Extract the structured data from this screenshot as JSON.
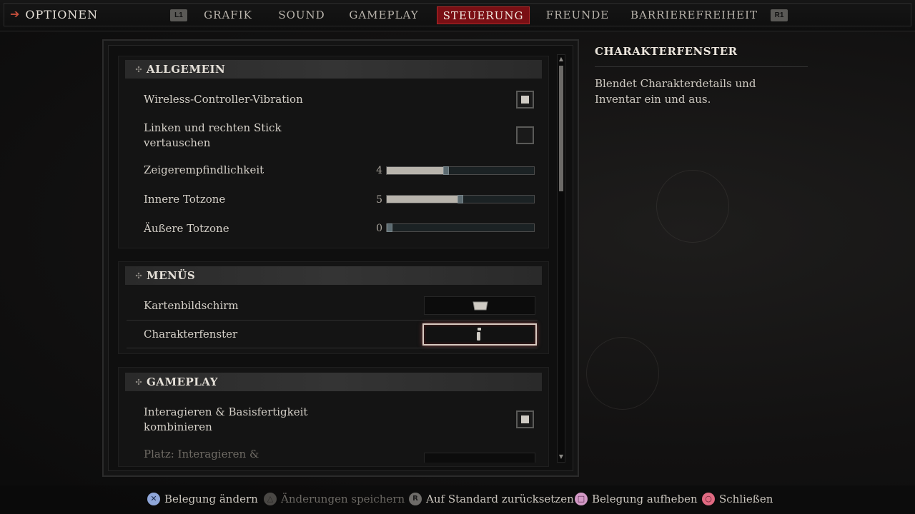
{
  "topbar": {
    "back_label": "OPTIONEN",
    "l1": "L1",
    "r1": "R1",
    "tabs": [
      {
        "label": "GRAFIK"
      },
      {
        "label": "SOUND"
      },
      {
        "label": "GAMEPLAY"
      },
      {
        "label": "STEUERUNG",
        "active": true
      },
      {
        "label": "FREUNDE"
      },
      {
        "label": "BARRIEREFREIHEIT"
      }
    ]
  },
  "sections": {
    "allgemein": {
      "title": "ALLGEMEIN",
      "vibration": {
        "label": "Wireless-Controller-Vibration",
        "checked": true
      },
      "swap_sticks": {
        "label_line1": "Linken und rechten Stick",
        "label_line2": "vertauschen",
        "checked": false
      },
      "pointer_sens": {
        "label": "Zeigerempfindlichkeit",
        "value": "4",
        "fraction": 0.4
      },
      "inner_deadzone": {
        "label": "Innere Totzone",
        "value": "5",
        "fraction": 0.5
      },
      "outer_deadzone": {
        "label": "Äußere Totzone",
        "value": "0",
        "fraction": 0.0
      }
    },
    "menus": {
      "title": "MENÜS",
      "map": {
        "label": "Kartenbildschirm",
        "binding_icon": "touchpad-icon"
      },
      "character": {
        "label": "Charakterfenster",
        "binding_icon": "options-button-icon"
      }
    },
    "gameplay": {
      "title": "GAMEPLAY",
      "combine": {
        "label_line1": "Interagieren & Basisfertigkeit",
        "label_line2": "kombinieren",
        "checked": true
      },
      "place": {
        "label": "Platz: Interagieren &"
      }
    }
  },
  "info": {
    "title": "CHARAKTERFENSTER",
    "description": "Blendet Charakterdetails und Inventar ein und aus."
  },
  "hints": [
    {
      "label": "Belegung ändern",
      "button": "cross",
      "color": "#8fa6d9",
      "enabled": true
    },
    {
      "label": "Änderungen speichern",
      "button": "triangle",
      "color": "#6b6863",
      "enabled": false
    },
    {
      "label": "Auf Standard zurücksetzen",
      "button": "R3",
      "color": "#8a8884",
      "enabled": true
    },
    {
      "label": "Belegung aufheben",
      "button": "square",
      "color": "#d39ac6",
      "enabled": true
    },
    {
      "label": "Schließen",
      "button": "circle",
      "color": "#e06a82",
      "enabled": true
    }
  ],
  "colors": {
    "accent_red": "#7a0f14",
    "slider_fill": "#b8b4ac"
  }
}
